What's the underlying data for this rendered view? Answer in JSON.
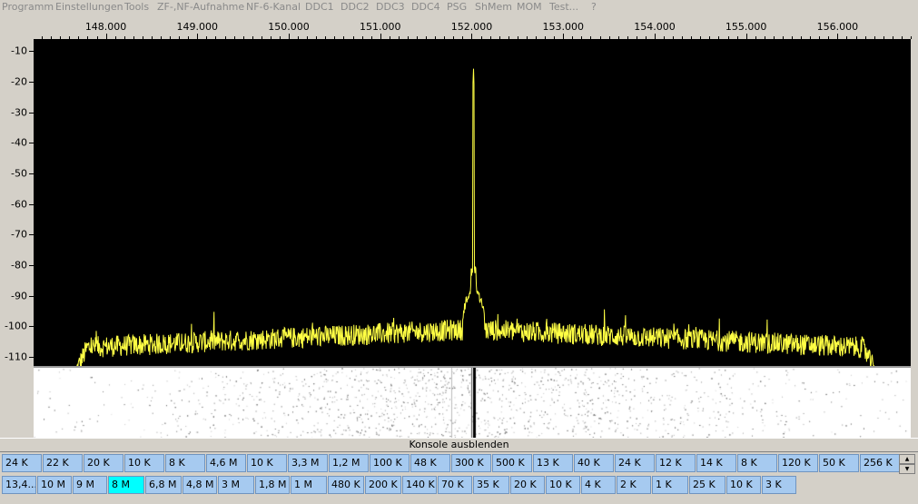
{
  "menu": [
    "Programm",
    "Einstellungen",
    "Tools",
    "ZF-,NF-Aufnahme",
    "NF-6-Kanal",
    "DDC1",
    "DDC2",
    "DDC3",
    "DDC4",
    "PSG",
    "ShMem",
    "MOM",
    "Test...",
    "?"
  ],
  "frequency_axis": {
    "tick_labels": [
      "148.000",
      "149.000",
      "150.000",
      "151.000",
      "152.000",
      "153.000",
      "154.000",
      "155.000",
      "156.000"
    ],
    "range": [
      147.21,
      156.8
    ]
  },
  "level_axis": {
    "tick_labels": [
      "-10",
      "-20",
      "-30",
      "-40",
      "-50",
      "-60",
      "-70",
      "-80",
      "-90",
      "-100",
      "-110"
    ],
    "range": [
      -113,
      -6
    ]
  },
  "spectrum": {
    "trace_color": "#ffff44",
    "background": "#000000",
    "start_freq": 147.68,
    "end_freq": 156.4,
    "peak_freq": 152.02,
    "peak_level": -21,
    "floor_level": -107
  },
  "waterfall": {
    "background": "#ffffff",
    "line_color": "#000000"
  },
  "console_toggle_label": "Konsole ausblenden",
  "bandwidth_row_1": [
    "24 K",
    "22 K",
    "20 K",
    "10 K",
    "8 K",
    "4,6 M",
    "10 K",
    "3,3 M",
    "1,2 M",
    "100 K",
    "48 K",
    "300 K",
    "500 K",
    "13 K",
    "40 K",
    "24 K",
    "12 K",
    "14 K",
    "8 K",
    "120 K",
    "50 K",
    "256 K"
  ],
  "bandwidth_row_2": [
    "13,4...",
    "10 M",
    "9 M",
    "8 M",
    "6,8 M",
    "4,8 M",
    "3 M",
    "1,8 M",
    "1 M",
    "480 K",
    "200 K",
    "140 K",
    "70 K",
    "35 K",
    "20 K",
    "10 K",
    "4 K",
    "2 K",
    "1 K",
    "25 K",
    "10 K",
    "3 K"
  ],
  "bandwidth_row_2_selected": "8 M",
  "active_color": "#00ffff",
  "button_color": "#a6caf0"
}
